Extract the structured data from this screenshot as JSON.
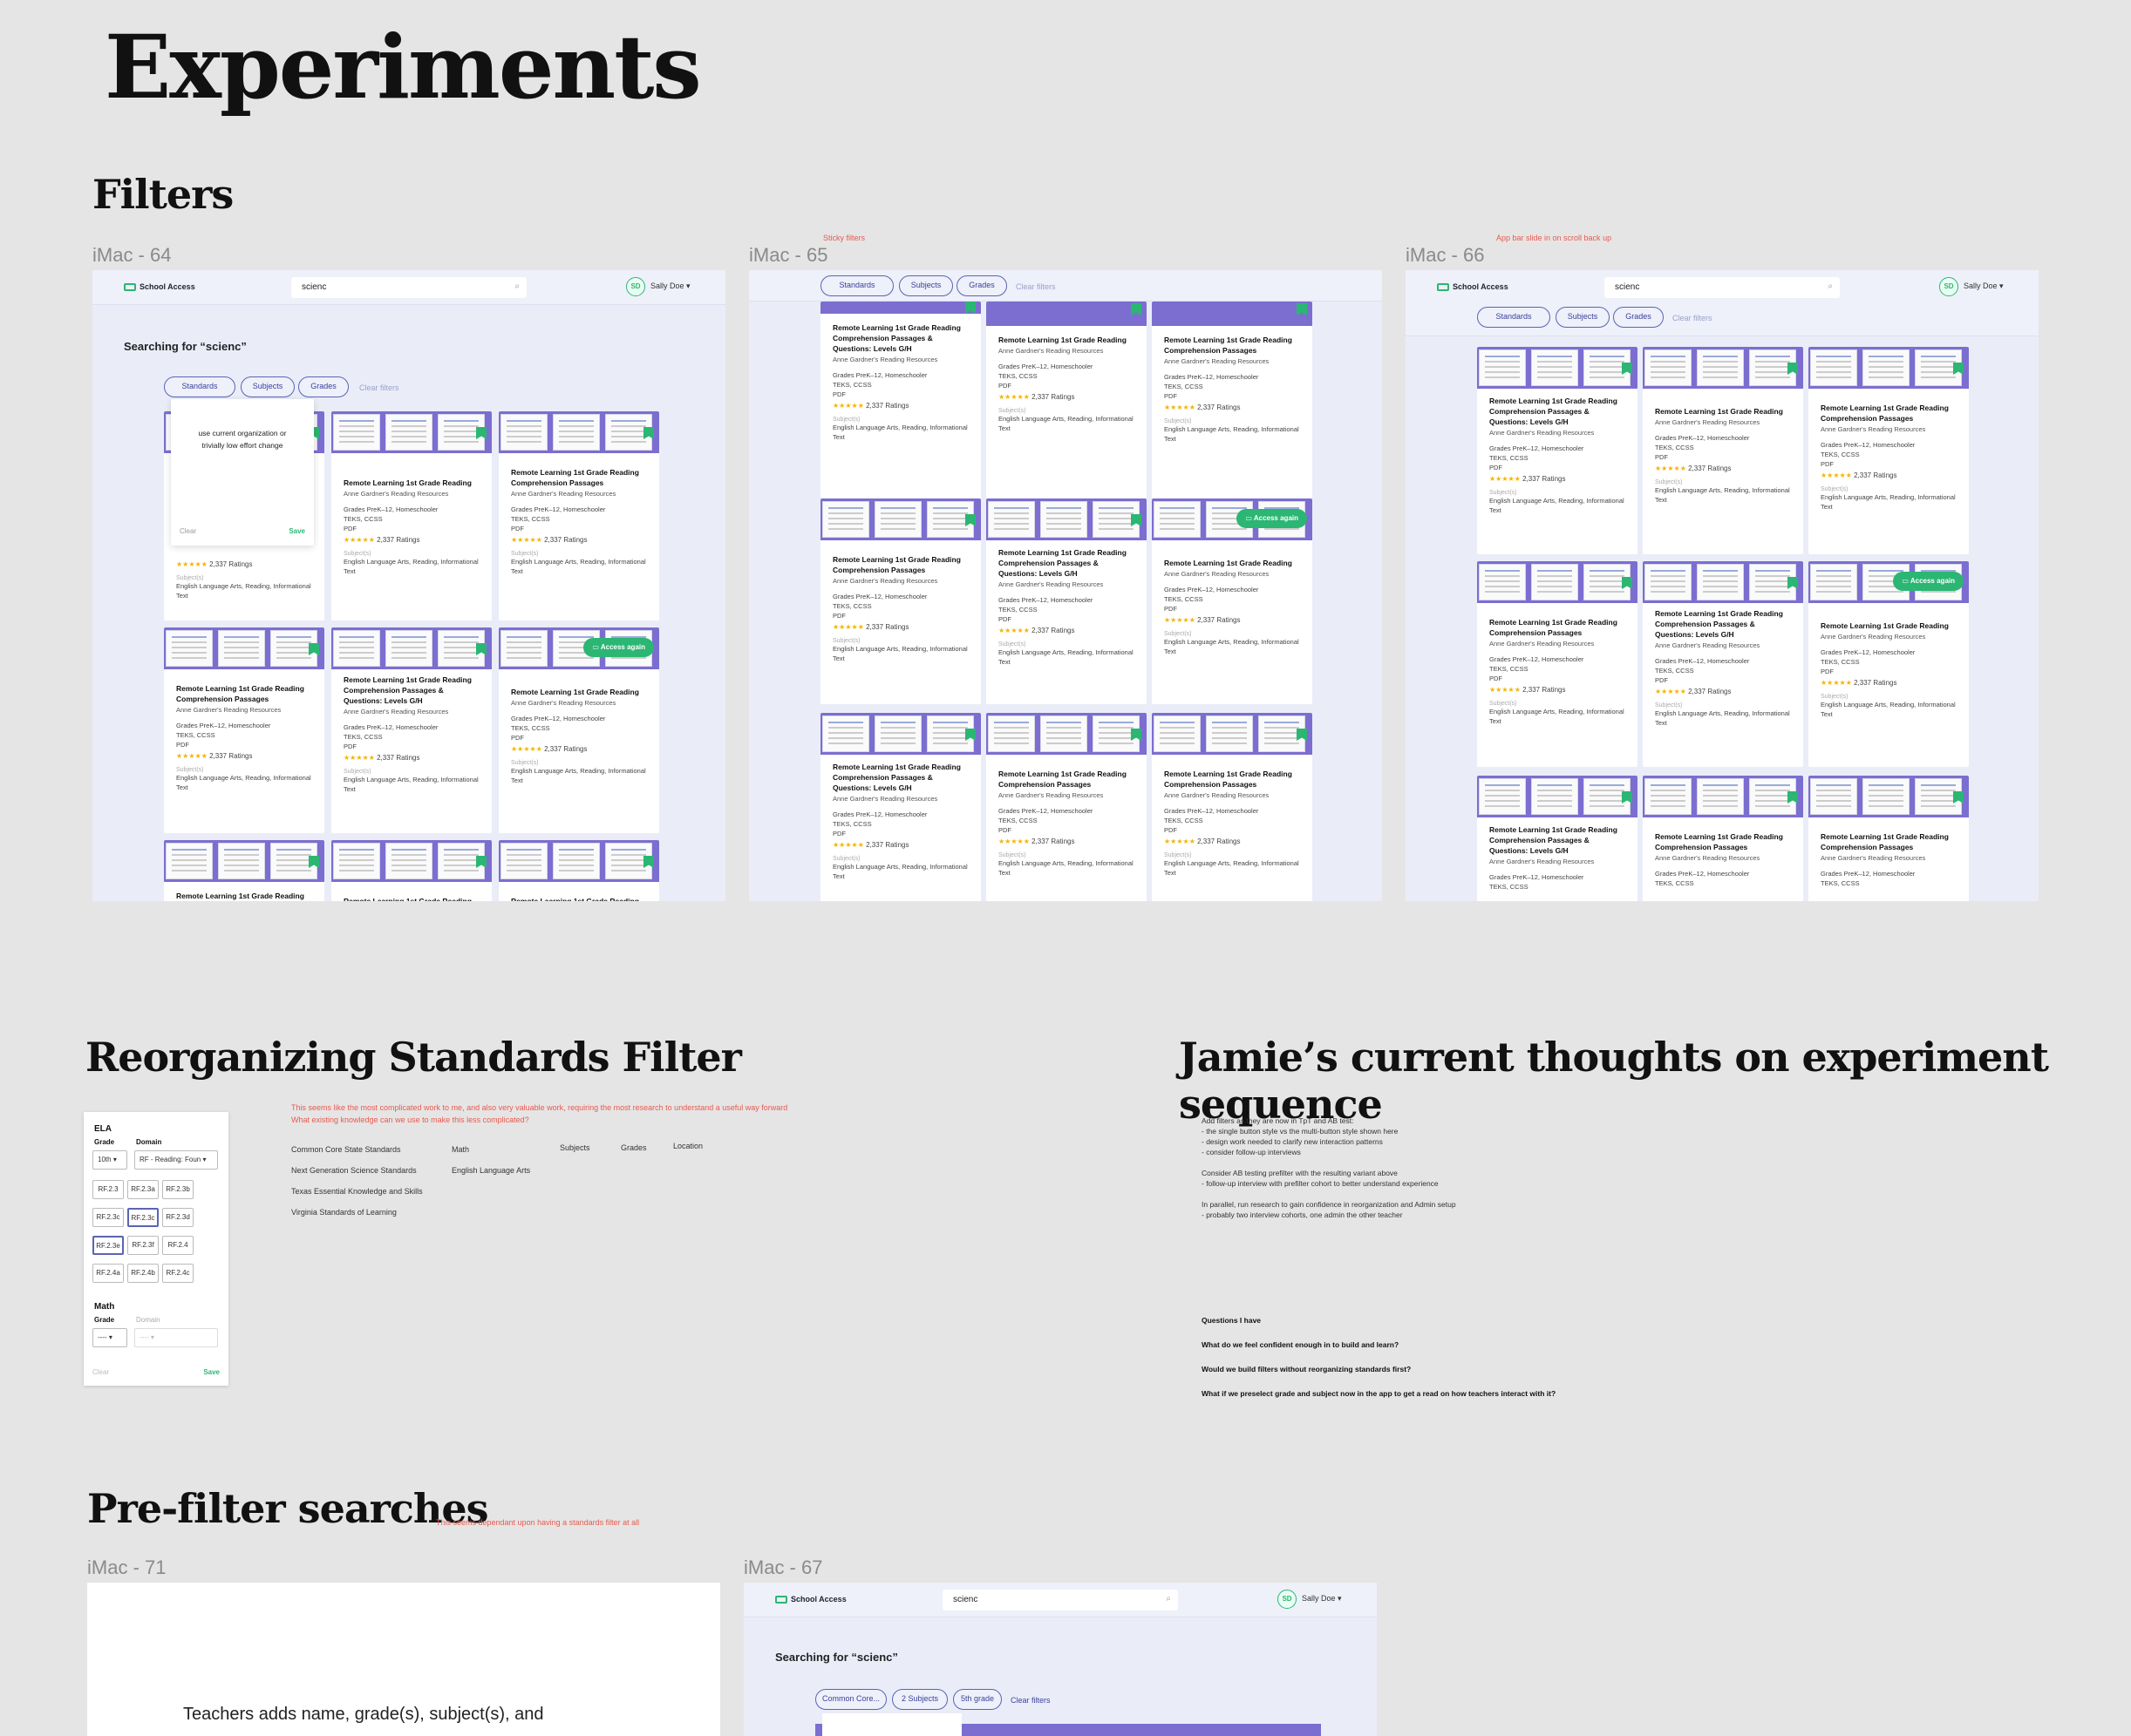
{
  "page_title": "Experiments",
  "sections": {
    "filters": "Filters",
    "reorganizing": "Reorganizing Standards Filter",
    "thoughts": "Jamie’s current thoughts on experiment sequence",
    "prefilter": "Pre-filter searches"
  },
  "frames": {
    "imac64": "iMac - 64",
    "imac65": "iMac - 65",
    "imac66": "iMac - 66",
    "imac71": "iMac - 71",
    "imac67": "iMac - 67"
  },
  "notes": {
    "sticky": "Sticky filters",
    "appbar": "App bar slide in on scroll back up",
    "reorg_1": "This seems like the most complicated work to me, and also very valuable work, requiring the most research to understand a useful way forward",
    "reorg_2": "What existing knowledge can we use to make this less complicated?",
    "prefilter": "This seems dependant upon having a standards filter at all"
  },
  "app": {
    "logo": "School Access",
    "search_value": "scienc",
    "user_initials": "SD",
    "user_name": "Sally Doe",
    "searching_label": "Searching for “scienc”",
    "filters": [
      "Standards",
      "Subjects",
      "Grades"
    ],
    "clear_filters": "Clear filters",
    "prefilter_pills": [
      "Common Core...",
      "2 Subjects",
      "5th grade"
    ],
    "access_again": "Access again"
  },
  "popover": {
    "text": "use current organization or trivially low effort change",
    "clear": "Clear",
    "save": "Save"
  },
  "card": {
    "title_a": "Remote Learning 1st Grade Reading Comprehension Passages & Questions: Levels G/H",
    "title_b": "Remote Learning 1st Grade Reading",
    "title_c": "Remote Learning 1st Grade Reading Comprehension Passages",
    "author": "Anne Gardner's Reading Resources",
    "grades": "Grades PreK–12, Homeschooler",
    "standards": "TEKS, CCSS",
    "format": "PDF",
    "ratings": "2,337 Ratings",
    "subjects_label": "Subject(s)",
    "subjects": "English Language Arts, Reading, Informational Text"
  },
  "standards_panel": {
    "ela": "ELA",
    "grade_label": "Grade",
    "domain_label": "Domain",
    "grade_value": "10th",
    "domain_value": "RF - Reading: Foun",
    "codes": [
      "RF.2.3",
      "RF.2.3a",
      "RF.2.3b",
      "RF.2.3c",
      "RF.2.3c",
      "RF.2.3d",
      "RF.2.3e",
      "RF.2.3f",
      "RF.2.4",
      "RF.2.4a",
      "RF.2.4b",
      "RF.2.4c"
    ],
    "math": "Math",
    "math_grade_value": "----",
    "math_domain_value": "----",
    "clear": "Clear",
    "save": "Save"
  },
  "standards_lists": {
    "standards": [
      "Common Core State Standards",
      "Next Generation Science Standards",
      "Texas Essential Knowledge and Skills",
      "Virginia Standards of Learning"
    ],
    "subjects_col": [
      "Math",
      "English Language Arts"
    ],
    "headers": [
      "Subjects",
      "Grades",
      "Location"
    ]
  },
  "thoughts": {
    "lines": [
      "Add filters as they are now in TpT and AB test:",
      "- the single button style vs the multi-button style shown here",
      "- design work needed to clarify new interaction patterns",
      "- consider follow-up interviews",
      "",
      "Consider AB testing prefilter with the resulting variant above",
      "- follow-up interview with prefilter cohort to better understand experience",
      "",
      "In parallel, run research to gain confidence in reorganization and Admin setup",
      "- probably two interview cohorts, one admin the other teacher"
    ],
    "questions_title": "Questions I have",
    "questions": [
      "What do we feel confident enough in to build and learn?",
      "Would we build filters without reorganizing  standards first?",
      "What if we preselect grade and subject now in the app to get a read on how teachers interact with it?"
    ]
  },
  "imac71_text": "Teachers adds name, grade(s), subject(s), and"
}
